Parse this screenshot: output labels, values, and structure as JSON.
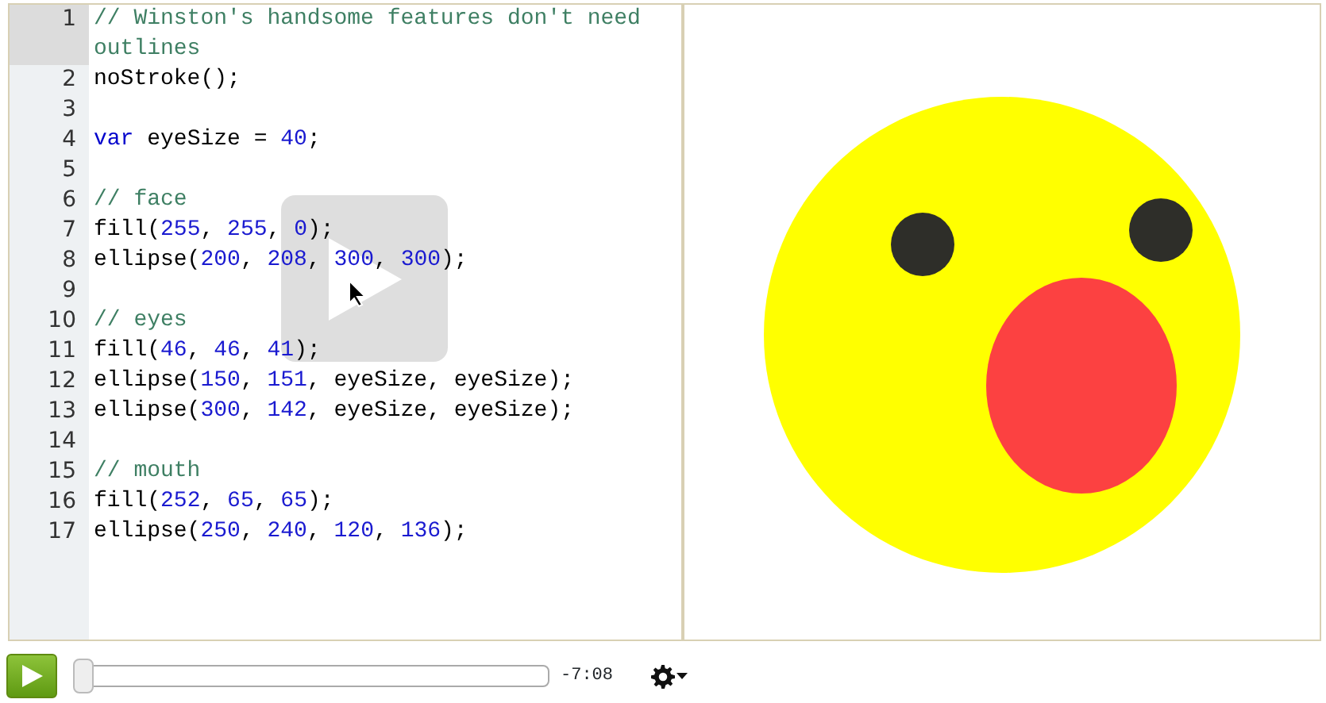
{
  "editor": {
    "lines": [
      {
        "number": "1",
        "active": true,
        "tokens": [
          {
            "kind": "comment",
            "text": "// Winston's handsome features don't need outlines"
          }
        ]
      },
      {
        "number": "2",
        "active": false,
        "tokens": [
          {
            "kind": "plain",
            "text": "noStroke();"
          }
        ]
      },
      {
        "number": "3",
        "active": false
      },
      {
        "number": "4",
        "active": false,
        "tokens": [
          {
            "kind": "keyword",
            "text": "var"
          },
          {
            "kind": "plain",
            "text": " eyeSize = "
          },
          {
            "kind": "number",
            "text": "40"
          },
          {
            "kind": "plain",
            "text": ";"
          }
        ]
      },
      {
        "number": "5",
        "active": false
      },
      {
        "number": "6",
        "active": false,
        "tokens": [
          {
            "kind": "comment",
            "text": "// face"
          }
        ]
      },
      {
        "number": "7",
        "active": false,
        "tokens": [
          {
            "kind": "plain",
            "text": "fill("
          },
          {
            "kind": "number",
            "text": "255"
          },
          {
            "kind": "plain",
            "text": ", "
          },
          {
            "kind": "number",
            "text": "255"
          },
          {
            "kind": "plain",
            "text": ", "
          },
          {
            "kind": "number",
            "text": "0"
          },
          {
            "kind": "plain",
            "text": ");"
          }
        ]
      },
      {
        "number": "8",
        "active": false,
        "tokens": [
          {
            "kind": "plain",
            "text": "ellipse("
          },
          {
            "kind": "number",
            "text": "200"
          },
          {
            "kind": "plain",
            "text": ", "
          },
          {
            "kind": "number",
            "text": "208"
          },
          {
            "kind": "plain",
            "text": ", "
          },
          {
            "kind": "number",
            "text": "300"
          },
          {
            "kind": "plain",
            "text": ", "
          },
          {
            "kind": "number",
            "text": "300"
          },
          {
            "kind": "plain",
            "text": ");"
          }
        ]
      },
      {
        "number": "9",
        "active": false
      },
      {
        "number": "10",
        "active": false,
        "tokens": [
          {
            "kind": "comment",
            "text": "// eyes"
          }
        ]
      },
      {
        "number": "11",
        "active": false,
        "tokens": [
          {
            "kind": "plain",
            "text": "fill("
          },
          {
            "kind": "number",
            "text": "46"
          },
          {
            "kind": "plain",
            "text": ", "
          },
          {
            "kind": "number",
            "text": "46"
          },
          {
            "kind": "plain",
            "text": ", "
          },
          {
            "kind": "number",
            "text": "41"
          },
          {
            "kind": "plain",
            "text": ");"
          }
        ]
      },
      {
        "number": "12",
        "active": false,
        "tokens": [
          {
            "kind": "plain",
            "text": "ellipse("
          },
          {
            "kind": "number",
            "text": "150"
          },
          {
            "kind": "plain",
            "text": ", "
          },
          {
            "kind": "number",
            "text": "151"
          },
          {
            "kind": "plain",
            "text": ", eyeSize, eyeSize);"
          }
        ]
      },
      {
        "number": "13",
        "active": false,
        "tokens": [
          {
            "kind": "plain",
            "text": "ellipse("
          },
          {
            "kind": "number",
            "text": "300"
          },
          {
            "kind": "plain",
            "text": ", "
          },
          {
            "kind": "number",
            "text": "142"
          },
          {
            "kind": "plain",
            "text": ", eyeSize, eyeSize);"
          }
        ]
      },
      {
        "number": "14",
        "active": false
      },
      {
        "number": "15",
        "active": false,
        "tokens": [
          {
            "kind": "comment",
            "text": "// mouth"
          }
        ]
      },
      {
        "number": "16",
        "active": false,
        "tokens": [
          {
            "kind": "plain",
            "text": "fill("
          },
          {
            "kind": "number",
            "text": "252"
          },
          {
            "kind": "plain",
            "text": ", "
          },
          {
            "kind": "number",
            "text": "65"
          },
          {
            "kind": "plain",
            "text": ", "
          },
          {
            "kind": "number",
            "text": "65"
          },
          {
            "kind": "plain",
            "text": ");"
          }
        ]
      },
      {
        "number": "17",
        "active": false,
        "tokens": [
          {
            "kind": "plain",
            "text": "ellipse("
          },
          {
            "kind": "number",
            "text": "250"
          },
          {
            "kind": "plain",
            "text": ", "
          },
          {
            "kind": "number",
            "text": "240"
          },
          {
            "kind": "plain",
            "text": ", "
          },
          {
            "kind": "number",
            "text": "120"
          },
          {
            "kind": "plain",
            "text": ", "
          },
          {
            "kind": "number",
            "text": "136"
          },
          {
            "kind": "plain",
            "text": ");"
          }
        ]
      }
    ]
  },
  "player": {
    "scrubber": {
      "level": 0.0
    },
    "time": "-7:08"
  }
}
